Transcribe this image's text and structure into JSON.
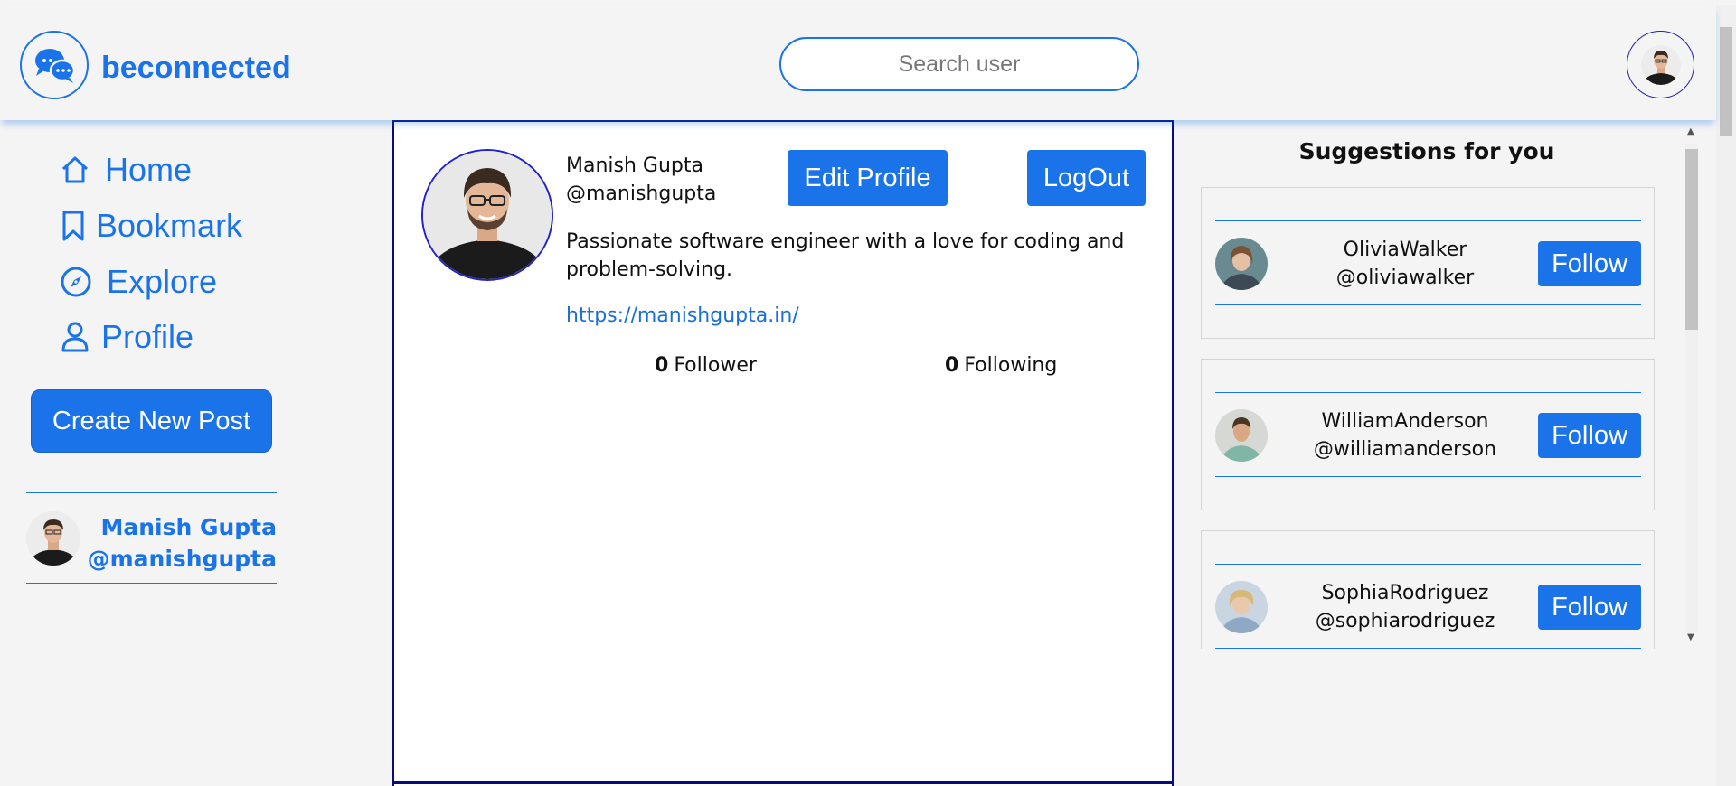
{
  "brand": {
    "name": "beconnected",
    "icon": "chat-bubbles-icon"
  },
  "search": {
    "placeholder": "Search user"
  },
  "header": {
    "avatar_icon": "user-avatar"
  },
  "nav": [
    {
      "label": "Home",
      "icon": "home-icon"
    },
    {
      "label": "Bookmark",
      "icon": "bookmark-icon"
    },
    {
      "label": "Explore",
      "icon": "compass-icon"
    },
    {
      "label": "Profile",
      "icon": "user-icon"
    }
  ],
  "sidebar": {
    "create_label": "Create New Post",
    "user_name": "Manish Gupta",
    "user_handle": "@manishgupta"
  },
  "profile": {
    "name": "Manish Gupta",
    "handle": "@manishgupta",
    "bio": "Passionate software engineer with a love for coding and problem-solving.",
    "link": "https://manishgupta.in/",
    "edit_label": "Edit Profile",
    "logout_label": "LogOut",
    "followers_count": "0",
    "followers_label": "Follower",
    "following_count": "0",
    "following_label": "Following"
  },
  "suggestions": {
    "title": "Suggestions for you",
    "items": [
      {
        "name": "OliviaWalker",
        "handle": "@oliviawalker",
        "follow_label": "Follow"
      },
      {
        "name": "WilliamAnderson",
        "handle": "@williamanderson",
        "follow_label": "Follow"
      },
      {
        "name": "SophiaRodriguez",
        "handle": "@sophiarodriguez",
        "follow_label": "Follow"
      }
    ]
  },
  "colors": {
    "accent": "#1a73e8",
    "panel_border": "#0a0a78",
    "background": "#f4f4f4"
  }
}
